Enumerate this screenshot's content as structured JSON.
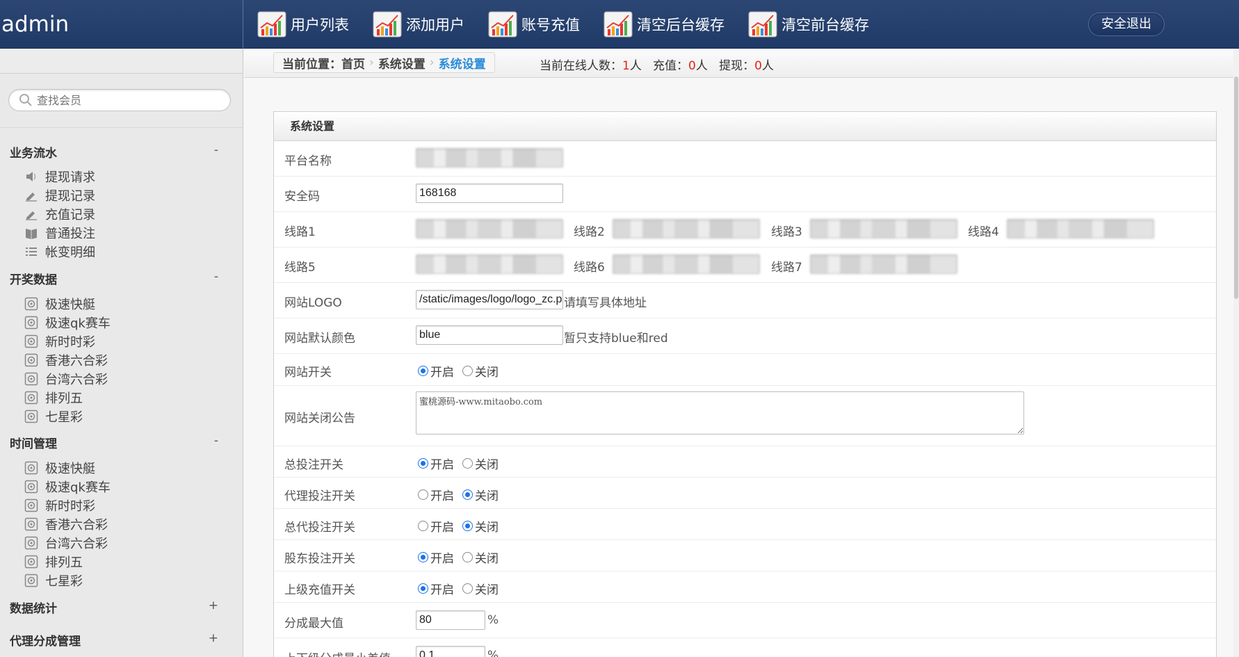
{
  "header": {
    "brand": "admin",
    "nav": [
      {
        "label": "用户列表"
      },
      {
        "label": "添加用户"
      },
      {
        "label": "账号充值"
      },
      {
        "label": "清空后台缓存"
      },
      {
        "label": "清空前台缓存"
      }
    ],
    "logout": "安全退出"
  },
  "sidebar": {
    "search_placeholder": "查找会员",
    "groups": [
      {
        "title": "业务流水",
        "toggle": "-",
        "items": [
          {
            "label": "提现请求",
            "icon": "speaker-icon"
          },
          {
            "label": "提现记录",
            "icon": "pencil-icon"
          },
          {
            "label": "充值记录",
            "icon": "pencil-icon"
          },
          {
            "label": "普通投注",
            "icon": "book-icon"
          },
          {
            "label": "帐变明细",
            "icon": "list-icon"
          }
        ]
      },
      {
        "title": "开奖数据",
        "toggle": "-",
        "items": [
          {
            "label": "极速快艇",
            "icon": "target-icon"
          },
          {
            "label": "极速qk赛车",
            "icon": "target-icon"
          },
          {
            "label": "新时时彩",
            "icon": "target-icon"
          },
          {
            "label": "香港六合彩",
            "icon": "target-icon"
          },
          {
            "label": "台湾六合彩",
            "icon": "target-icon"
          },
          {
            "label": "排列五",
            "icon": "target-icon"
          },
          {
            "label": "七星彩",
            "icon": "target-icon"
          }
        ]
      },
      {
        "title": "时间管理",
        "toggle": "-",
        "items": [
          {
            "label": "极速快艇",
            "icon": "target-icon"
          },
          {
            "label": "极速qk赛车",
            "icon": "target-icon"
          },
          {
            "label": "新时时彩",
            "icon": "target-icon"
          },
          {
            "label": "香港六合彩",
            "icon": "target-icon"
          },
          {
            "label": "台湾六合彩",
            "icon": "target-icon"
          },
          {
            "label": "排列五",
            "icon": "target-icon"
          },
          {
            "label": "七星彩",
            "icon": "target-icon"
          }
        ]
      },
      {
        "title": "数据统计",
        "toggle": "+",
        "items": []
      },
      {
        "title": "代理分成管理",
        "toggle": "+",
        "items": []
      }
    ]
  },
  "breadcrumb": {
    "prefix": "当前位置：",
    "items": [
      "首页",
      "系统设置",
      "系统设置"
    ]
  },
  "online": {
    "online_label": "当前在线人数：",
    "online_count": "1",
    "online_unit": "人",
    "recharge_label": "充值：",
    "recharge_count": "0",
    "recharge_unit": "人",
    "withdraw_label": "提现：",
    "withdraw_count": "0",
    "withdraw_unit": "人"
  },
  "panel": {
    "title": "系统设置",
    "rows": {
      "platform_name": {
        "label": "平台名称"
      },
      "security_code": {
        "label": "安全码",
        "value": "168168"
      },
      "line1": {
        "label": "线路1",
        "line2": "线路2",
        "line3": "线路3",
        "line4": "线路4"
      },
      "line5": {
        "label": "线路5",
        "line6": "线路6",
        "line7": "线路7"
      },
      "logo": {
        "label": "网站LOGO",
        "value": "/static/images/logo/logo_zc.png",
        "hint": "请填写具体地址"
      },
      "color": {
        "label": "网站默认颜色",
        "value": "blue",
        "hint": "暂只支持blue和red"
      },
      "site_switch": {
        "label": "网站开关",
        "on": "开启",
        "off": "关闭",
        "selected": "on"
      },
      "close_notice": {
        "label": "网站关闭公告",
        "value": "蜜桃源码-www.mitaobo.com"
      },
      "bet_switch": {
        "label": "总投注开关",
        "on": "开启",
        "off": "关闭",
        "selected": "on"
      },
      "agent_bet": {
        "label": "代理投注开关",
        "on": "开启",
        "off": "关闭",
        "selected": "off"
      },
      "general_agent_bet": {
        "label": "总代投注开关",
        "on": "开启",
        "off": "关闭",
        "selected": "off"
      },
      "shareholder_bet": {
        "label": "股东投注开关",
        "on": "开启",
        "off": "关闭",
        "selected": "on"
      },
      "upline_recharge": {
        "label": "上级充值开关",
        "on": "开启",
        "off": "关闭",
        "selected": "on"
      },
      "max_share": {
        "label": "分成最大值",
        "value": "80",
        "unit": "%"
      },
      "min_diff": {
        "label": "上下级分成最小差值",
        "value": "0.1",
        "unit": "%"
      }
    }
  },
  "colors": {
    "header_bg": "#1f3a66",
    "accent_blue": "#2a8bd8",
    "count_red": "#e4221b"
  }
}
